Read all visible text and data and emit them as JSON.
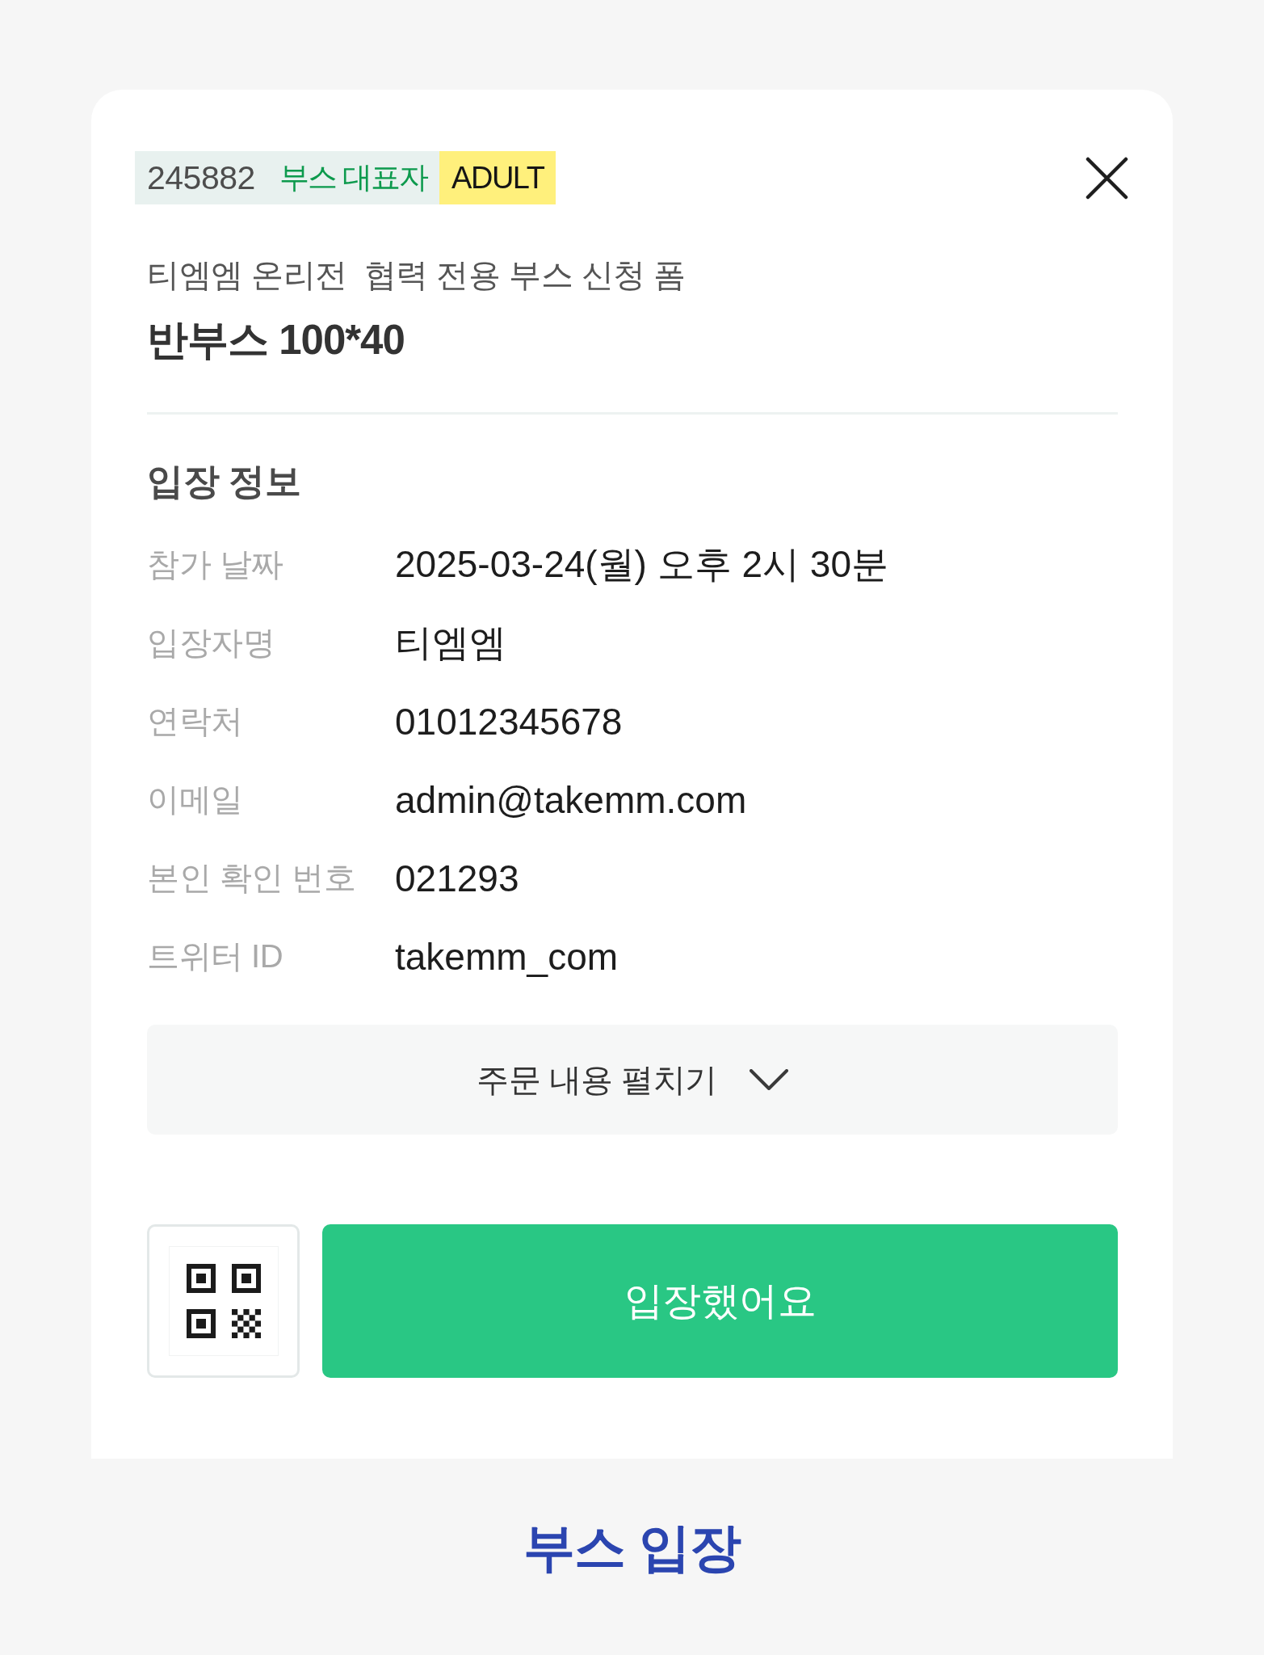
{
  "header": {
    "tags": [
      {
        "kind": "id",
        "text": "245882"
      },
      {
        "kind": "role",
        "text": "부스 대표자"
      },
      {
        "kind": "age",
        "text": "ADULT"
      }
    ]
  },
  "form_title": "티엠엠 온리전  협력 전용 부스 신청 폼",
  "booth_name": "반부스 100*40",
  "entry_info": {
    "title": "입장 정보",
    "rows": [
      {
        "label": "참가 날짜",
        "value": "2025-03-24(월) 오후 2시 30분"
      },
      {
        "label": "입장자명",
        "value": "티엠엠"
      },
      {
        "label": "연락처",
        "value": "01012345678"
      },
      {
        "label": "이메일",
        "value": "admin@takemm.com"
      },
      {
        "label": "본인 확인 번호",
        "value": "021293"
      },
      {
        "label": "트위터 ID",
        "value": "takemm_com"
      }
    ]
  },
  "expand_button": {
    "label": "주문 내용 펼치기",
    "expanded": false
  },
  "confirm_button": {
    "label": "입장했어요"
  },
  "caption": "부스 입장"
}
